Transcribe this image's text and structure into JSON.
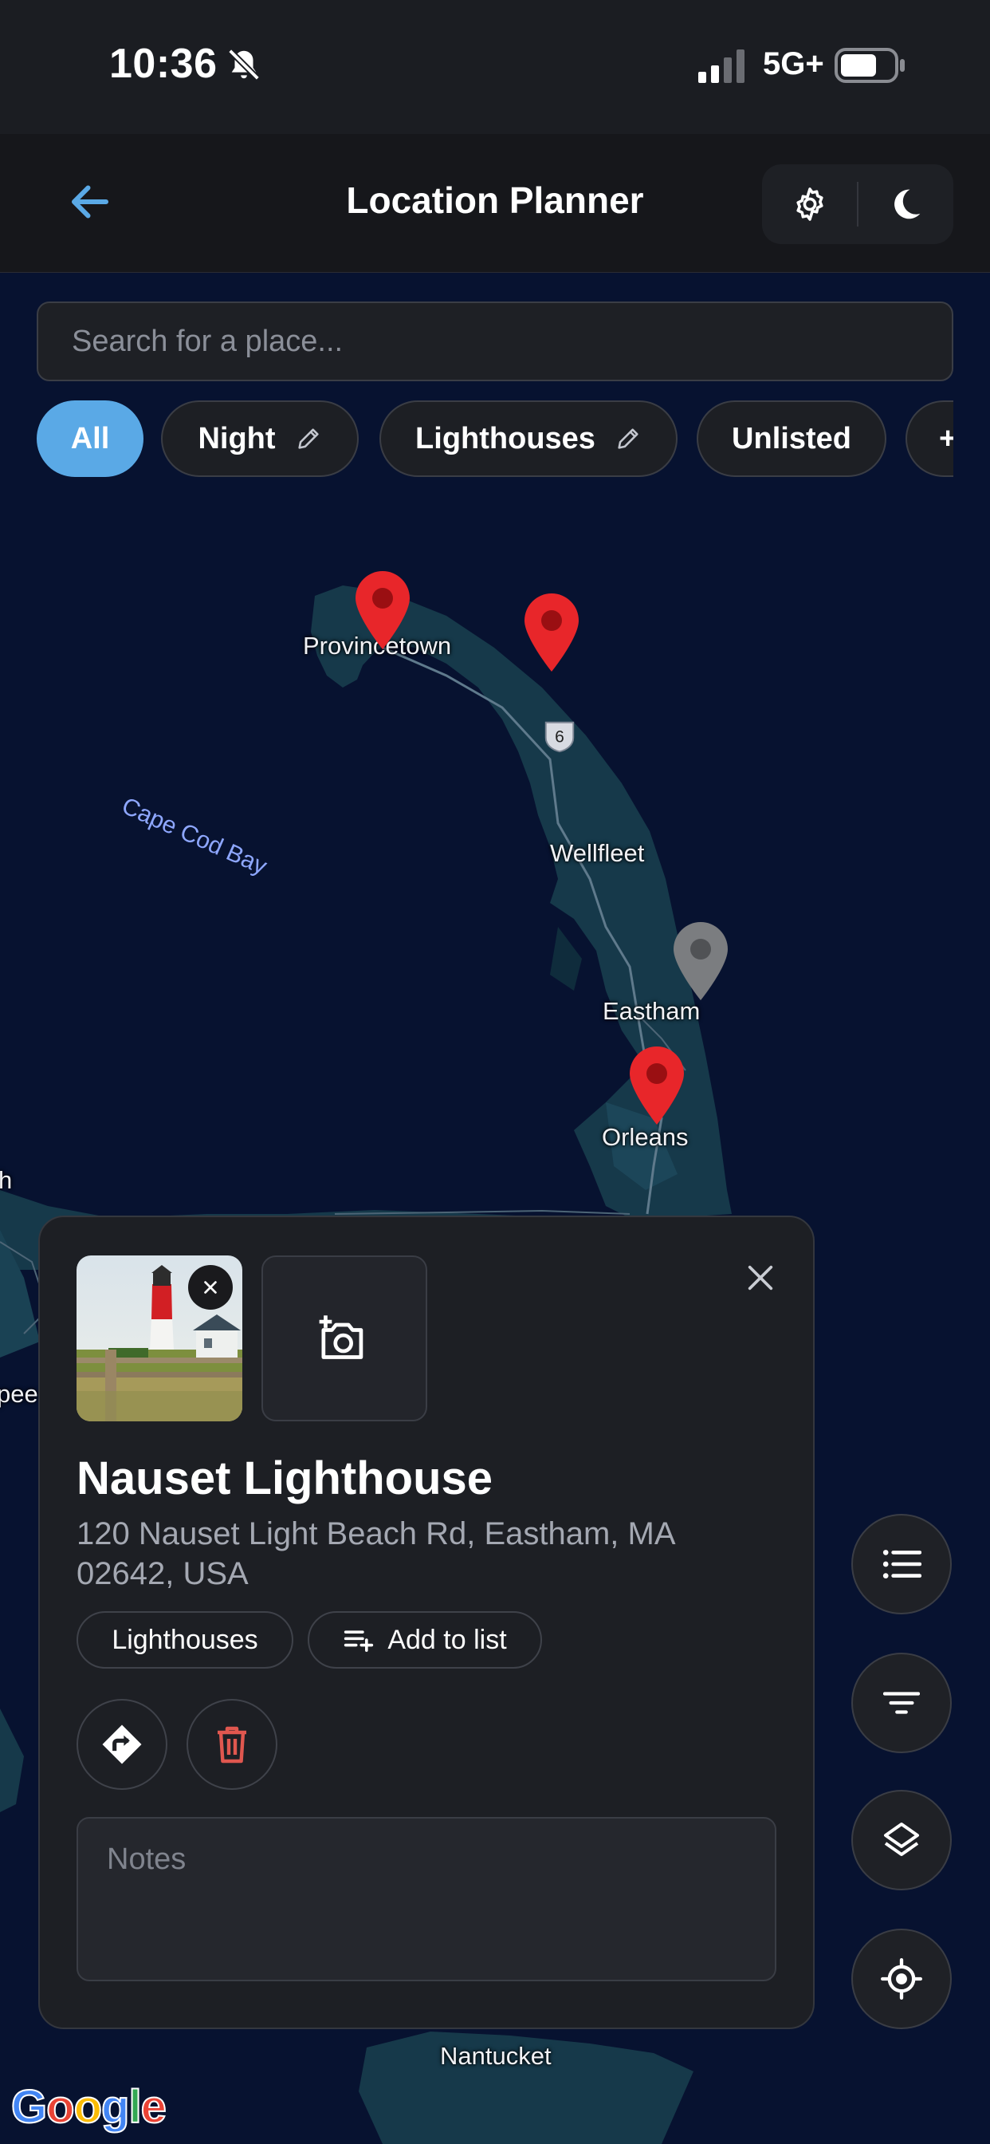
{
  "status_bar": {
    "time": "10:36",
    "network": "5G+"
  },
  "header": {
    "title": "Location Planner"
  },
  "search": {
    "placeholder": "Search for a place..."
  },
  "filters": [
    {
      "label": "All",
      "active": true,
      "editable": false
    },
    {
      "label": "Night",
      "active": false,
      "editable": true
    },
    {
      "label": "Lighthouses",
      "active": false,
      "editable": true
    },
    {
      "label": "Unlisted",
      "active": false,
      "editable": false
    },
    {
      "label": "+",
      "active": false,
      "editable": false
    }
  ],
  "map": {
    "labels": {
      "provincetown": "Provincetown",
      "wellfleet": "Wellfleet",
      "eastham": "Eastham",
      "orleans": "Orleans",
      "nantucket": "Nantucket",
      "cape_cod_bay": "Cape Cod Bay",
      "edge_left_1": "h",
      "edge_left_2": "pee"
    },
    "route_number": "6",
    "pins": [
      {
        "name": "pin-provincetown",
        "color": "#e8262a"
      },
      {
        "name": "pin-north-truro",
        "color": "#e8262a"
      },
      {
        "name": "pin-eastham",
        "color": "#7b7d80"
      },
      {
        "name": "pin-orleans",
        "color": "#e8262a"
      }
    ]
  },
  "place_card": {
    "name": "Nauset Lighthouse",
    "address": "120 Nauset Light Beach Rd, Eastham, MA 02642, USA",
    "tag": "Lighthouses",
    "add_to_list_label": "Add to list",
    "notes_placeholder": "Notes"
  },
  "controls": [
    "list-icon",
    "filter-icon",
    "layers-icon",
    "locate-icon"
  ],
  "attribution": "Google",
  "colors": {
    "accent": "#5aa9e6",
    "pin_red": "#e8262a",
    "delete_red": "#e0574f",
    "map_water": "#071230",
    "map_land": "#16394a"
  }
}
